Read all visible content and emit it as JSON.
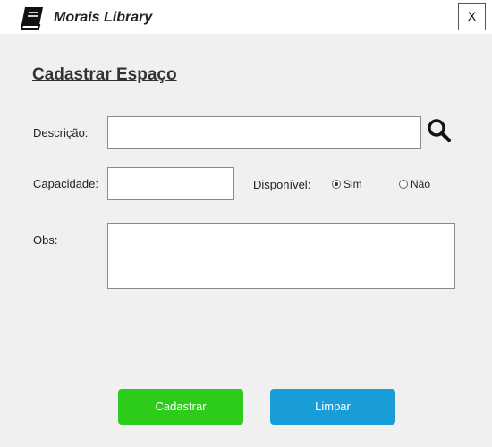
{
  "window": {
    "title": "Morais Library",
    "close_label": "X",
    "icon": "book-icon"
  },
  "form": {
    "heading": "Cadastrar Espaço",
    "descricao": {
      "label": "Descrição:",
      "value": ""
    },
    "search_icon": "search-icon",
    "capacidade": {
      "label": "Capacidade:",
      "value": ""
    },
    "disponivel": {
      "label": "Disponível:",
      "options": [
        "Sim",
        "Não"
      ],
      "selected": "Sim"
    },
    "obs": {
      "label": "Obs:",
      "value": ""
    }
  },
  "buttons": {
    "submit_label": "Cadastrar",
    "clear_label": "Limpar"
  },
  "colors": {
    "submit": "#2ecc1a",
    "clear": "#199dd8"
  }
}
